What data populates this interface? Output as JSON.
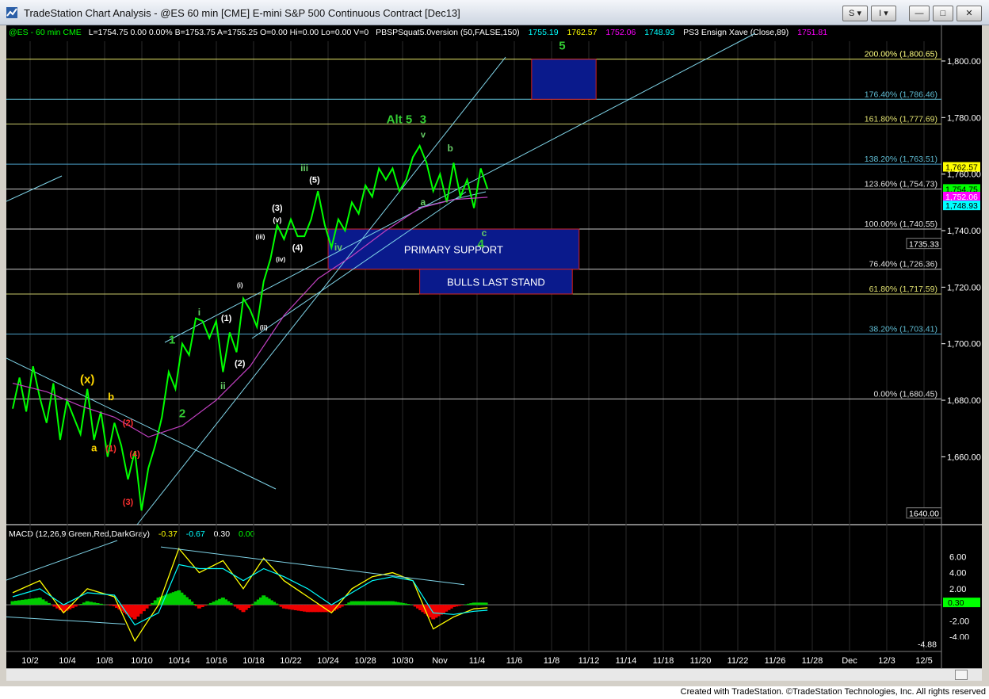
{
  "window": {
    "title": "TradeStation Chart Analysis - @ES 60 min [CME] E-mini S&P 500 Continuous Contract [Dec13]",
    "buttons": {
      "s": "S",
      "i": "I",
      "minimize": "—",
      "restore": "□",
      "close": "✕"
    }
  },
  "status_line": {
    "symbol": "@ES - 60 min  CME",
    "quote": "L=1754.75  0.00  0.00%  B=1753.75  A=1755.25  O=0.00  Hi=0.00  Lo=0.00  V=0",
    "indicator1_name": "PBSPSquat5.0version (50,FALSE,150)",
    "indicator1_values": [
      "1755.19",
      "1762.57",
      "1752.06",
      "1748.93"
    ],
    "indicator2_name": "PS3 Ensign Xave  (Close,89)",
    "indicator2_value": "1751.81"
  },
  "price_axis": {
    "ticks": [
      {
        "price": 1800,
        "label": "1,800.00"
      },
      {
        "price": 1780,
        "label": "1,780.00"
      },
      {
        "price": 1760,
        "label": "1,760.00"
      },
      {
        "price": 1740,
        "label": "1,740.00"
      },
      {
        "price": 1720,
        "label": "1,720.00"
      },
      {
        "price": 1700,
        "label": "1,700.00"
      },
      {
        "price": 1680,
        "label": "1,680.00"
      },
      {
        "price": 1660,
        "label": "1,660.00"
      }
    ],
    "badges": [
      {
        "price": 1762.57,
        "label": "1,762.57",
        "bg": "#ffff00",
        "fg": "#000000"
      },
      {
        "price": 1754.75,
        "label": "1,754.75",
        "bg": "#00ff00",
        "fg": "#000000"
      },
      {
        "price": 1752.06,
        "label": "1,752.06",
        "bg": "#ff00ff",
        "fg": "#ffffff"
      },
      {
        "price": 1748.93,
        "label": "1,748.93",
        "bg": "#00ffff",
        "fg": "#000000"
      }
    ],
    "boxed_labels": [
      {
        "price": 1735.33,
        "label": "1735.33"
      },
      {
        "price": 1640,
        "label": "1640.00"
      }
    ]
  },
  "fib_levels": [
    {
      "price": 1800.65,
      "label": "200.00% (1,800.65)",
      "color": "#e8e86a",
      "text": "#ffff80"
    },
    {
      "price": 1786.46,
      "label": "176.40% (1,786.46)",
      "color": "#5fbcd3",
      "text": "#5fbcd3"
    },
    {
      "price": 1777.69,
      "label": "161.80% (1,777.69)",
      "color": "#c8c86a",
      "text": "#e0e070"
    },
    {
      "price": 1763.51,
      "label": "138.20% (1,763.51)",
      "color": "#4aa0c8",
      "text": "#5fbcd3"
    },
    {
      "price": 1754.73,
      "label": "123.60% (1,754.73)",
      "color": "#c8c8c8",
      "text": "#e0e0e0"
    },
    {
      "price": 1740.55,
      "label": "100.00% (1,740.55)",
      "color": "#c8c8c8",
      "text": "#e0e0e0"
    },
    {
      "price": 1726.36,
      "label": "76.40% (1,726.36)",
      "color": "#c8c8c8",
      "text": "#e0e0e0"
    },
    {
      "price": 1717.59,
      "label": "61.80% (1,717.59)",
      "color": "#c8c86a",
      "text": "#e0e070"
    },
    {
      "price": 1703.41,
      "label": "38.20% (1,703.41)",
      "color": "#4aa0c8",
      "text": "#5fbcd3"
    },
    {
      "price": 1680.45,
      "label": "0.00% (1,680.45)",
      "color": "#c8c8c8",
      "text": "#e0e0e0"
    }
  ],
  "zones": [
    {
      "label": "",
      "from_date_index": 15.3,
      "to_date_index": 17.2,
      "top": 1800.65,
      "bottom": 1786.46
    },
    {
      "label": "PRIMARY SUPPORT",
      "from_date_index": 9.3,
      "to_date_index": 16.7,
      "top": 1740.55,
      "bottom": 1726.36
    },
    {
      "label": "BULLS LAST STAND",
      "from_date_index": 12.0,
      "to_date_index": 16.5,
      "top": 1726.36,
      "bottom": 1717.59
    }
  ],
  "wave_labels": [
    {
      "text": "5",
      "d": 16.2,
      "p": 1804,
      "color": "#33cc33",
      "size": 15
    },
    {
      "text": "Alt 5",
      "d": 11.4,
      "p": 1778,
      "color": "#33cc33",
      "size": 15
    },
    {
      "text": "3",
      "d": 12.1,
      "p": 1778,
      "color": "#33cc33",
      "size": 15
    },
    {
      "text": "v",
      "d": 12.1,
      "p": 1773,
      "color": "#66cc66",
      "size": 11
    },
    {
      "text": "b",
      "d": 12.9,
      "p": 1768,
      "color": "#66cc66",
      "size": 12
    },
    {
      "text": "iii",
      "d": 8.6,
      "p": 1761,
      "color": "#66cc66",
      "size": 12
    },
    {
      "text": "(5)",
      "d": 8.9,
      "p": 1757,
      "color": "#ffffff",
      "size": 11
    },
    {
      "text": "a",
      "d": 12.1,
      "p": 1749,
      "color": "#66cc66",
      "size": 12
    },
    {
      "text": "c",
      "d": 13.9,
      "p": 1738,
      "color": "#66cc66",
      "size": 12
    },
    {
      "text": "4",
      "d": 13.8,
      "p": 1734,
      "color": "#33cc33",
      "size": 15
    },
    {
      "text": "(3)",
      "d": 7.8,
      "p": 1747,
      "color": "#ffffff",
      "size": 11
    },
    {
      "text": "(v)",
      "d": 7.8,
      "p": 1743,
      "color": "#ffffff",
      "size": 9
    },
    {
      "text": "(iii)",
      "d": 7.3,
      "p": 1737,
      "color": "#ffffff",
      "size": 8
    },
    {
      "text": "(4)",
      "d": 8.4,
      "p": 1733,
      "color": "#ffffff",
      "size": 11
    },
    {
      "text": "iv",
      "d": 9.6,
      "p": 1733,
      "color": "#66cc66",
      "size": 12
    },
    {
      "text": "(iv)",
      "d": 7.9,
      "p": 1729,
      "color": "#ffffff",
      "size": 8
    },
    {
      "text": "(i)",
      "d": 6.7,
      "p": 1720,
      "color": "#ffffff",
      "size": 8
    },
    {
      "text": "i",
      "d": 5.5,
      "p": 1710,
      "color": "#66cc66",
      "size": 12
    },
    {
      "text": "(1)",
      "d": 6.3,
      "p": 1708,
      "color": "#ffffff",
      "size": 11
    },
    {
      "text": "(ii)",
      "d": 7.4,
      "p": 1705,
      "color": "#ffffff",
      "size": 8
    },
    {
      "text": "1",
      "d": 4.7,
      "p": 1700,
      "color": "#33cc33",
      "size": 15
    },
    {
      "text": "(2)",
      "d": 6.7,
      "p": 1692,
      "color": "#ffffff",
      "size": 11
    },
    {
      "text": "ii",
      "d": 6.2,
      "p": 1684,
      "color": "#66cc66",
      "size": 12
    },
    {
      "text": "2",
      "d": 5.0,
      "p": 1674,
      "color": "#33cc33",
      "size": 15
    },
    {
      "text": "(x)",
      "d": 2.2,
      "p": 1686,
      "color": "#ffd700",
      "size": 15
    },
    {
      "text": "b",
      "d": 2.9,
      "p": 1680,
      "color": "#ffd700",
      "size": 13
    },
    {
      "text": "(2)",
      "d": 3.4,
      "p": 1671,
      "color": "#ff3030",
      "size": 11
    },
    {
      "text": "a",
      "d": 2.4,
      "p": 1662,
      "color": "#ffd700",
      "size": 13
    },
    {
      "text": "(1)",
      "d": 2.9,
      "p": 1662,
      "color": "#ff3030",
      "size": 11
    },
    {
      "text": "(4)",
      "d": 3.6,
      "p": 1660,
      "color": "#ff3030",
      "size": 11
    },
    {
      "text": "(3)",
      "d": 3.4,
      "p": 1643,
      "color": "#ff3030",
      "size": 11
    }
  ],
  "price_series": [
    [
      0,
      1677
    ],
    [
      0.2,
      1688
    ],
    [
      0.4,
      1676
    ],
    [
      0.6,
      1692
    ],
    [
      0.8,
      1681
    ],
    [
      1.0,
      1672
    ],
    [
      1.2,
      1686
    ],
    [
      1.4,
      1666
    ],
    [
      1.6,
      1680
    ],
    [
      1.8,
      1674
    ],
    [
      2.0,
      1668
    ],
    [
      2.2,
      1684
    ],
    [
      2.4,
      1666
    ],
    [
      2.6,
      1676
    ],
    [
      2.8,
      1660
    ],
    [
      3.0,
      1672
    ],
    [
      3.2,
      1664
    ],
    [
      3.4,
      1652
    ],
    [
      3.6,
      1662
    ],
    [
      3.8,
      1641
    ],
    [
      4.0,
      1656
    ],
    [
      4.2,
      1664
    ],
    [
      4.4,
      1674
    ],
    [
      4.6,
      1690
    ],
    [
      4.8,
      1684
    ],
    [
      5.0,
      1700
    ],
    [
      5.2,
      1696
    ],
    [
      5.4,
      1709
    ],
    [
      5.6,
      1708
    ],
    [
      5.8,
      1702
    ],
    [
      6.0,
      1708
    ],
    [
      6.2,
      1690
    ],
    [
      6.4,
      1704
    ],
    [
      6.6,
      1697
    ],
    [
      6.8,
      1716
    ],
    [
      7.0,
      1712
    ],
    [
      7.2,
      1706
    ],
    [
      7.4,
      1722
    ],
    [
      7.6,
      1730
    ],
    [
      7.8,
      1742
    ],
    [
      8.0,
      1737
    ],
    [
      8.2,
      1744
    ],
    [
      8.4,
      1738
    ],
    [
      8.6,
      1738
    ],
    [
      8.8,
      1744
    ],
    [
      9.0,
      1754
    ],
    [
      9.2,
      1742
    ],
    [
      9.4,
      1734
    ],
    [
      9.6,
      1744
    ],
    [
      9.8,
      1740
    ],
    [
      10.0,
      1750
    ],
    [
      10.2,
      1746
    ],
    [
      10.4,
      1756
    ],
    [
      10.6,
      1752
    ],
    [
      10.8,
      1762
    ],
    [
      11.0,
      1758
    ],
    [
      11.2,
      1762
    ],
    [
      11.4,
      1754
    ],
    [
      11.6,
      1758
    ],
    [
      11.8,
      1766
    ],
    [
      12.0,
      1770
    ],
    [
      12.2,
      1764
    ],
    [
      12.4,
      1754
    ],
    [
      12.6,
      1760
    ],
    [
      12.8,
      1750
    ],
    [
      13.0,
      1764
    ],
    [
      13.2,
      1752
    ],
    [
      13.4,
      1758
    ],
    [
      13.6,
      1748
    ],
    [
      13.8,
      1762
    ],
    [
      14.0,
      1754.75
    ]
  ],
  "ma_series": [
    [
      0,
      1686
    ],
    [
      1,
      1683
    ],
    [
      2,
      1678
    ],
    [
      3,
      1674
    ],
    [
      4,
      1667
    ],
    [
      5,
      1671
    ],
    [
      6,
      1680
    ],
    [
      7,
      1692
    ],
    [
      8,
      1710
    ],
    [
      9,
      1723
    ],
    [
      10,
      1731
    ],
    [
      11,
      1740
    ],
    [
      12,
      1748
    ],
    [
      13,
      1751
    ],
    [
      14,
      1751.8
    ]
  ],
  "date_axis": [
    "10/2",
    "10/4",
    "10/8",
    "10/10",
    "10/14",
    "10/16",
    "10/18",
    "10/22",
    "10/24",
    "10/28",
    "10/30",
    "Nov",
    "11/4",
    "11/6",
    "11/8",
    "11/12",
    "11/14",
    "11/18",
    "11/20",
    "11/22",
    "11/26",
    "11/28",
    "Dec",
    "12/3",
    "12/5"
  ],
  "macd": {
    "title": "MACD (12,26,9,Green,Red,DarkGray)",
    "values": [
      "-0.37",
      "-0.67",
      "0.30",
      "0.00"
    ],
    "value_colors": [
      "#ffff00",
      "#00ffff",
      "#ffffff",
      "#00ff00"
    ],
    "ticks": [
      {
        "v": 6,
        "label": "6.00"
      },
      {
        "v": 4,
        "label": "4.00"
      },
      {
        "v": 2,
        "label": "2.00"
      },
      {
        "v": -2,
        "label": "-2.00"
      },
      {
        "v": -4,
        "label": "-4.00"
      }
    ],
    "badges": [
      {
        "v": 0.3,
        "label": "0.30",
        "bg": "#00ff00",
        "fg": "#000000"
      },
      {
        "v": -4.88,
        "label": "-4.88",
        "bg": "#000000",
        "fg": "#ffffff"
      }
    ],
    "macd_line": [
      [
        0,
        1.5
      ],
      [
        0.8,
        3
      ],
      [
        1.5,
        -1
      ],
      [
        2.2,
        2
      ],
      [
        3,
        1
      ],
      [
        3.6,
        -4.5
      ],
      [
        4.3,
        0
      ],
      [
        4.9,
        7
      ],
      [
        5.5,
        4
      ],
      [
        6.2,
        5.5
      ],
      [
        6.8,
        2
      ],
      [
        7.4,
        5.8
      ],
      [
        8,
        3
      ],
      [
        8.7,
        1
      ],
      [
        9.4,
        -1
      ],
      [
        10,
        2
      ],
      [
        10.6,
        3.5
      ],
      [
        11.2,
        4
      ],
      [
        11.8,
        3
      ],
      [
        12.4,
        -3
      ],
      [
        13,
        -1.5
      ],
      [
        13.6,
        -0.5
      ],
      [
        14,
        -0.37
      ]
    ],
    "signal_line": [
      [
        0,
        1
      ],
      [
        0.8,
        2
      ],
      [
        1.5,
        0
      ],
      [
        2.2,
        1.5
      ],
      [
        3,
        1.2
      ],
      [
        3.6,
        -2.5
      ],
      [
        4.3,
        -1
      ],
      [
        4.9,
        5
      ],
      [
        5.5,
        4.5
      ],
      [
        6.2,
        4.5
      ],
      [
        6.8,
        3
      ],
      [
        7.4,
        4.5
      ],
      [
        8,
        3.5
      ],
      [
        8.7,
        2
      ],
      [
        9.4,
        0
      ],
      [
        10,
        1.5
      ],
      [
        10.6,
        3
      ],
      [
        11.2,
        3.5
      ],
      [
        11.8,
        3
      ],
      [
        12.4,
        -1
      ],
      [
        13,
        -1.2
      ],
      [
        13.6,
        -0.8
      ],
      [
        14,
        -0.67
      ]
    ]
  },
  "footer": "Created with TradeStation. ©TradeStation Technologies, Inc. All rights reserved"
}
